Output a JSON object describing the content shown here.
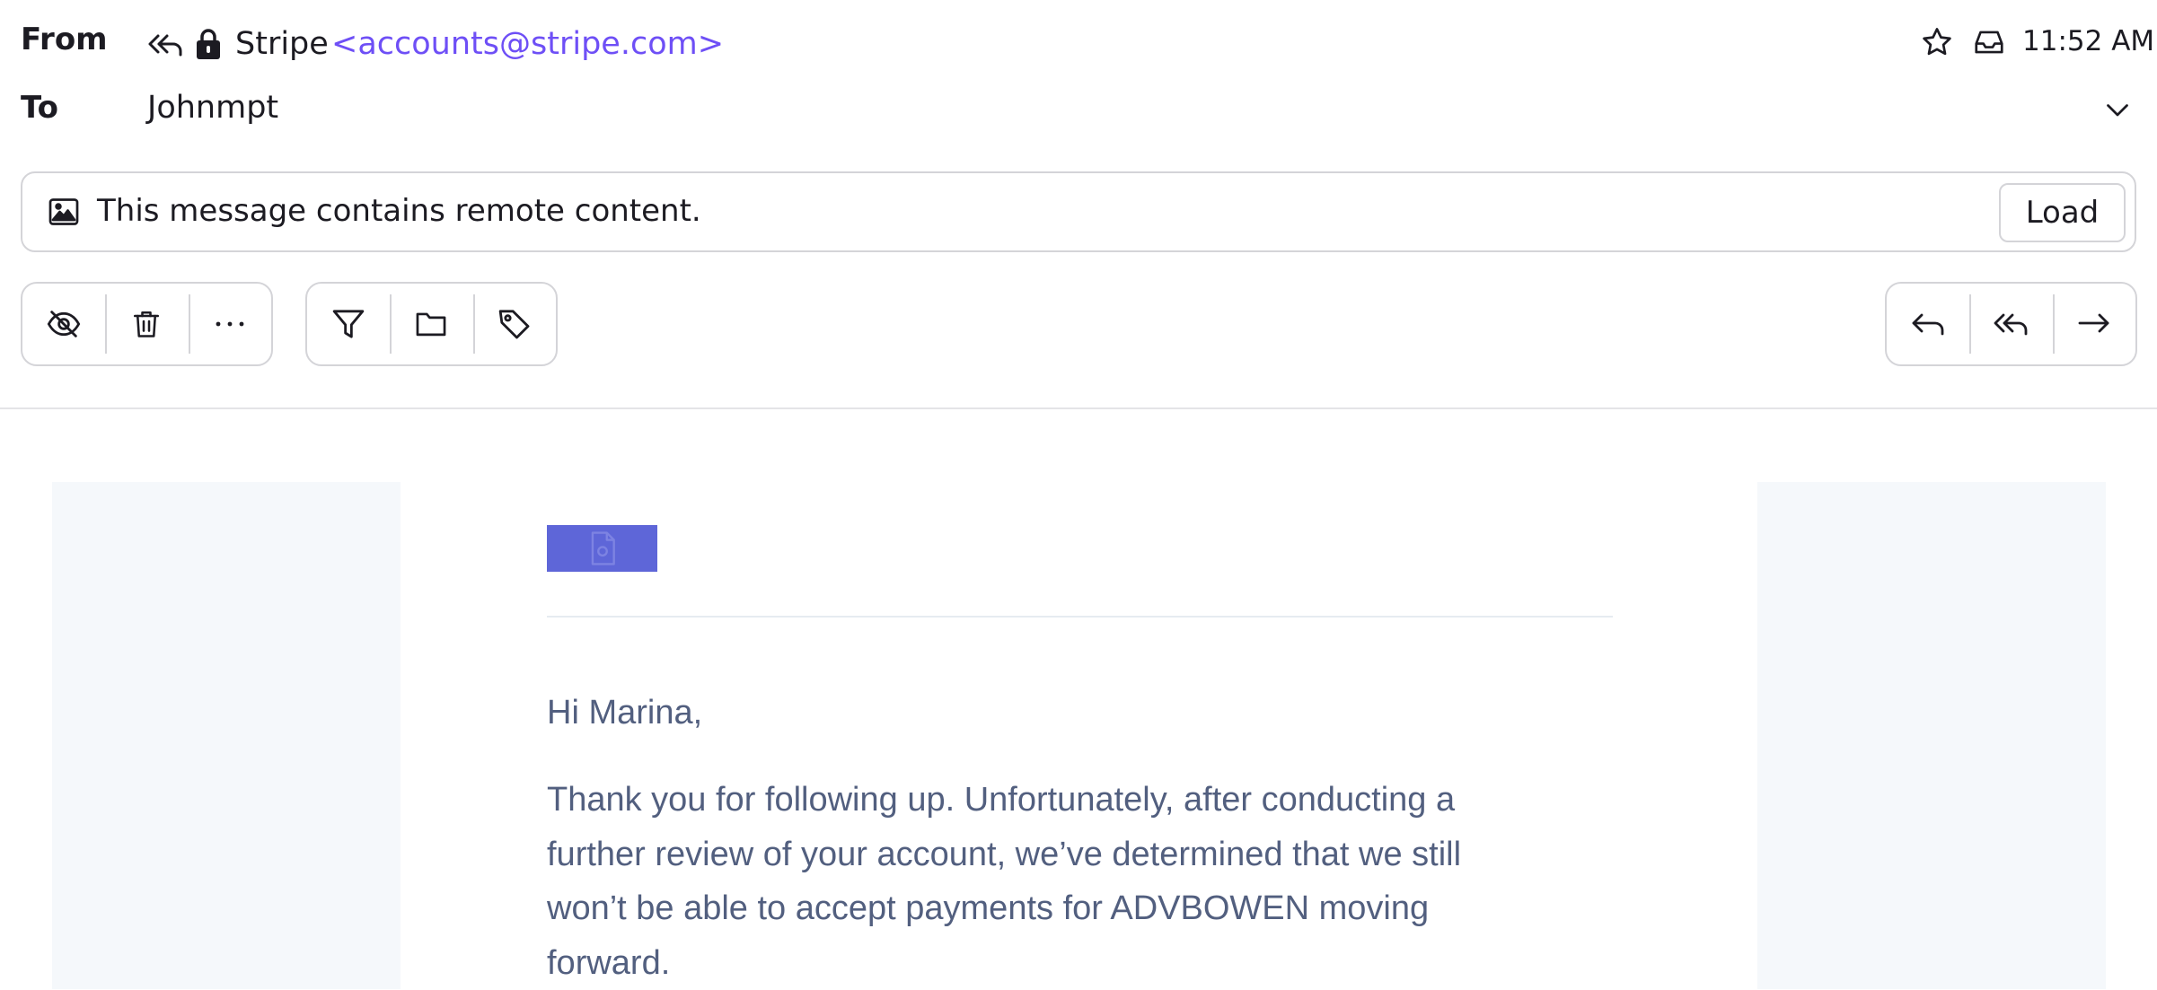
{
  "header": {
    "from_label": "From",
    "to_label": "To",
    "sender_name": "Stripe",
    "sender_address": "<accounts@stripe.com>",
    "recipient": "Johnmpt",
    "time": "11:52 AM"
  },
  "remote_content": {
    "message": "This message contains remote content.",
    "load_label": "Load"
  },
  "toolbar": {
    "left_group": [
      {
        "icon": "eye-off-icon",
        "action": "mark-unread"
      },
      {
        "icon": "trash-icon",
        "action": "delete"
      },
      {
        "icon": "more-icon",
        "action": "more"
      }
    ],
    "middle_group": [
      {
        "icon": "filter-icon",
        "action": "filter"
      },
      {
        "icon": "folder-icon",
        "action": "move"
      },
      {
        "icon": "tag-icon",
        "action": "label"
      }
    ],
    "right_group": [
      {
        "icon": "reply-icon",
        "action": "reply"
      },
      {
        "icon": "reply-all-icon",
        "action": "reply-all"
      },
      {
        "icon": "forward-icon",
        "action": "forward"
      }
    ]
  },
  "body": {
    "greeting": "Hi Marina,",
    "paragraph_lines": [
      "Thank you for following up. Unfortunately, after conducting a",
      "further review of your account, we’ve determined that we still",
      "won’t be able to accept payments for ADVBOWEN moving",
      "forward."
    ]
  },
  "colors": {
    "accent": "#6e4ff6",
    "body_text": "#525f7f",
    "stripe_brand": "#5e66d8",
    "email_side_bg": "#f5f8fb"
  }
}
